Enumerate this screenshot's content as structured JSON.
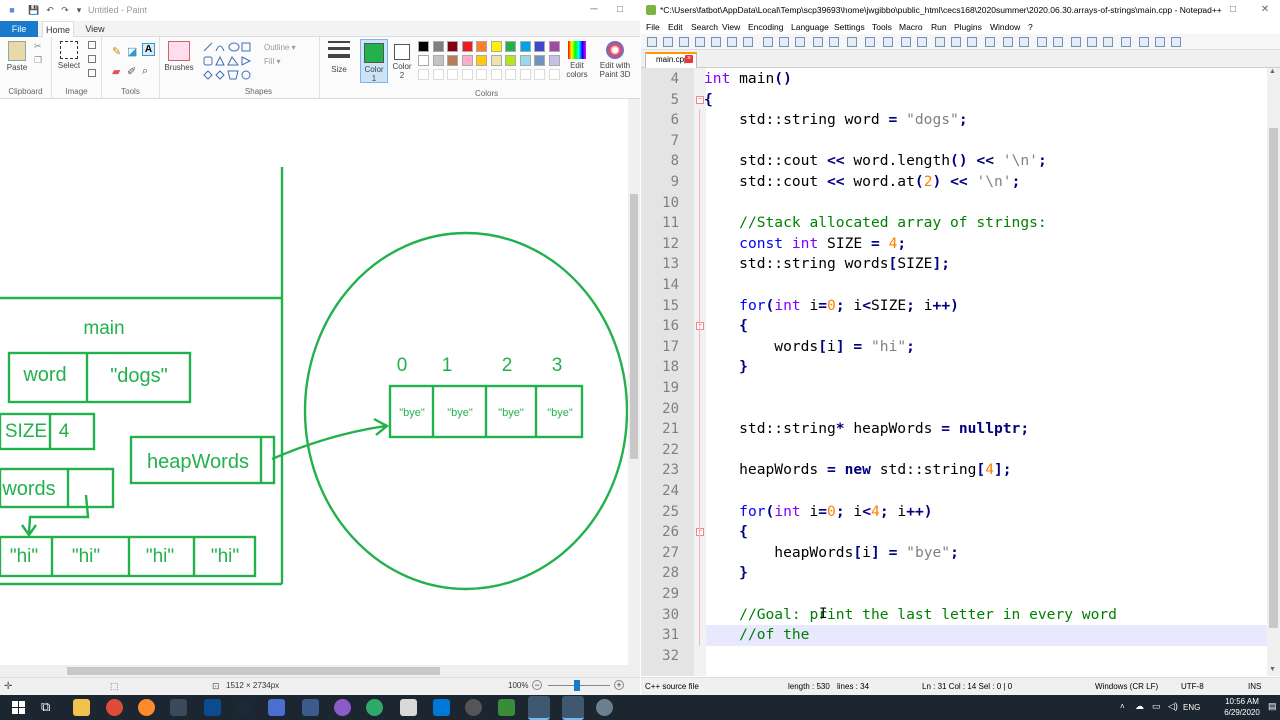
{
  "paint": {
    "title": "Untitled - Paint",
    "file_tab": "File",
    "tabs": [
      "Home",
      "View"
    ],
    "groups": {
      "clipboard": "Clipboard",
      "image": "Image",
      "tools": "Tools",
      "shapes": "Shapes",
      "colors": "Colors"
    },
    "buttons": {
      "paste": "Paste",
      "select": "Select",
      "brushes": "Brushes",
      "outline": "Outline",
      "fill": "Fill",
      "size": "Size",
      "color1": "Color 1",
      "color2": "Color 2",
      "edit_colors": "Edit colors",
      "edit_paint3d": "Edit with Paint 3D"
    },
    "palette_row1": [
      "#000000",
      "#7f7f7f",
      "#880015",
      "#ed1c24",
      "#ff7f27",
      "#fff200",
      "#22b14c",
      "#00a2e8",
      "#3f48cc",
      "#a349a4"
    ],
    "palette_row2": [
      "#ffffff",
      "#c3c3c3",
      "#b97a57",
      "#ffaec9",
      "#ffc90e",
      "#efe4b0",
      "#b5e61d",
      "#99d9ea",
      "#7092be",
      "#c8bfe7"
    ],
    "color1_value": "#22b14c",
    "canvas": {
      "frame_label": "main",
      "word_label": "word",
      "word_value": "\"dogs\"",
      "size_label": "SIZE",
      "size_value": "4",
      "words_label": "words",
      "heap_label": "heapWords",
      "hi_values": [
        "\"hi\"",
        "\"hi\"",
        "\"hi\"",
        "\"hi\""
      ],
      "indices": [
        "0",
        "1",
        "2",
        "3"
      ],
      "bye_values": [
        "\"bye\"",
        "\"bye\"",
        "\"bye\"",
        "\"bye\""
      ],
      "stroke_color": "#22b14c"
    },
    "status": {
      "dimensions": "1512 × 2734px",
      "zoom": "100%"
    }
  },
  "npp": {
    "title": "*C:\\Users\\fatbot\\AppData\\Local\\Temp\\scp39693\\home\\jwgibbo\\public_html\\cecs168\\2020summer\\2020.06.30.arrays-of-strings\\main.cpp - Notepad++",
    "menu": [
      "File",
      "Edit",
      "Search",
      "View",
      "Encoding",
      "Language",
      "Settings",
      "Tools",
      "Macro",
      "Run",
      "Plugins",
      "Window",
      "?"
    ],
    "tab": "main.cpp",
    "line_numbers": [
      "4",
      "5",
      "6",
      "7",
      "8",
      "9",
      "10",
      "11",
      "12",
      "13",
      "14",
      "15",
      "16",
      "17",
      "18",
      "19",
      "20",
      "21",
      "22",
      "23",
      "24",
      "25",
      "26",
      "27",
      "28",
      "29",
      "30",
      "31",
      "32"
    ],
    "code": {
      "l4": "int main()",
      "l5": "{",
      "l6a": "    std::string word ",
      "l6b": "=",
      "l6c": " \"dogs\"",
      "l6d": ";",
      "l8": "    std::cout << word.length() << '\\n';",
      "l9": "    std::cout << word.at(2) << '\\n';",
      "l11": "    //Stack allocated array of strings:",
      "l12": "    const int SIZE = 4;",
      "l13": "    std::string words[SIZE];",
      "l15": "    for(int i=0; i<SIZE; i++)",
      "l16": "    {",
      "l17": "        words[i] = \"hi\";",
      "l18": "    }",
      "l21": "    std::string* heapWords = nullptr;",
      "l23": "    heapWords = new std::string[4];",
      "l25": "    for(int i=0; i<4; i++)",
      "l26": "    {",
      "l27": "        heapWords[i] = \"bye\";",
      "l28": "    }",
      "l30": "    //Goal: print the last letter in every word",
      "l31": "    //of the"
    },
    "status": {
      "lang": "C++ source file",
      "length": "length : 530",
      "lines": "lines : 34",
      "pos": "Ln : 31   Col : 14   Sel : 0 | 0",
      "eol": "Windows (CR LF)",
      "enc": "UTF-8",
      "mode": "INS"
    }
  },
  "taskbar": {
    "lang": "ENG",
    "time": "10:56 AM",
    "date": "6/29/2020"
  }
}
